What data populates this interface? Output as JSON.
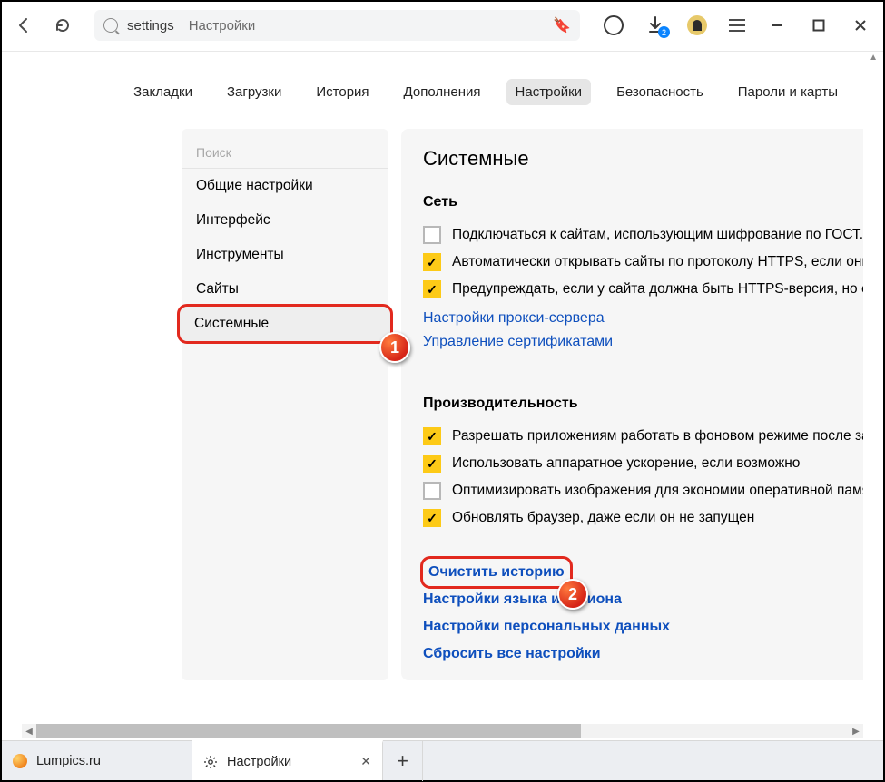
{
  "toolbar": {
    "address_primary": "settings",
    "address_secondary": "Настройки",
    "download_badge": "2"
  },
  "nav": {
    "items": [
      {
        "label": "Закладки"
      },
      {
        "label": "Загрузки"
      },
      {
        "label": "История"
      },
      {
        "label": "Дополнения"
      },
      {
        "label": "Настройки"
      },
      {
        "label": "Безопасность"
      },
      {
        "label": "Пароли и карты"
      }
    ]
  },
  "sidebar": {
    "search_placeholder": "Поиск",
    "items": [
      {
        "label": "Общие настройки"
      },
      {
        "label": "Интерфейс"
      },
      {
        "label": "Инструменты"
      },
      {
        "label": "Сайты"
      },
      {
        "label": "Системные"
      }
    ]
  },
  "content": {
    "heading": "Системные",
    "network": {
      "title": "Сеть",
      "opts": [
        {
          "checked": false,
          "label": "Подключаться к сайтам, использующим шифрование по ГОСТ."
        },
        {
          "checked": true,
          "label": "Автоматически открывать сайты по протоколу HTTPS, если они"
        },
        {
          "checked": true,
          "label": "Предупреждать, если у сайта должна быть HTTPS-версия, но её"
        }
      ],
      "links": [
        "Настройки прокси-сервера",
        "Управление сертификатами"
      ]
    },
    "perf": {
      "title": "Производительность",
      "opts": [
        {
          "checked": true,
          "label": "Разрешать приложениям работать в фоновом режиме после за"
        },
        {
          "checked": true,
          "label": "Использовать аппаратное ускорение, если возможно"
        },
        {
          "checked": false,
          "label": "Оптимизировать изображения для экономии оперативной памя"
        },
        {
          "checked": true,
          "label": "Обновлять браузер, даже если он не запущен"
        }
      ]
    },
    "action_links": {
      "clear_history": "Очистить историю",
      "lang_region": "Настройки языка и региона",
      "personal": "Настройки персональных данных",
      "reset": "Сбросить все настройки"
    }
  },
  "callouts": {
    "one": "1",
    "two": "2"
  },
  "tabs": {
    "items": [
      {
        "title": "Lumpics.ru"
      },
      {
        "title": "Настройки"
      }
    ],
    "newtab": "+"
  }
}
